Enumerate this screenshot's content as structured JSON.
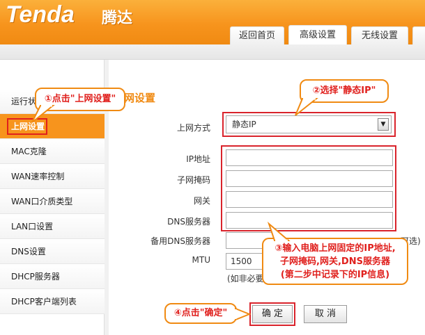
{
  "brand": {
    "logo": "Tenda",
    "logo_cn": "腾达"
  },
  "tabs": [
    {
      "label": "返回首页"
    },
    {
      "label": "高级设置"
    },
    {
      "label": "无线设置"
    },
    {
      "label": ""
    }
  ],
  "sidebar": {
    "items": [
      {
        "label": "运行状"
      },
      {
        "label": "上网设置"
      },
      {
        "label": "MAC克隆"
      },
      {
        "label": "WAN速率控制"
      },
      {
        "label": "WAN口介质类型"
      },
      {
        "label": "LAN口设置"
      },
      {
        "label": "DNS设置"
      },
      {
        "label": "DHCP服务器"
      },
      {
        "label": "DHCP客户端列表"
      }
    ]
  },
  "main": {
    "title": "网设置",
    "connection_type_label": "上网方式",
    "connection_type_value": "静态IP",
    "fields": {
      "ip_label": "IP地址",
      "mask_label": "子网掩码",
      "gateway_label": "网关",
      "dns_label": "DNS服务器",
      "dns2_label": "备用DNS服务器",
      "dns2_suffix": "可选)",
      "mtu_label": "MTU",
      "mtu_value": "1500",
      "mtu_note": "(如非必要"
    },
    "buttons": {
      "ok": "确 定",
      "cancel": "取 消"
    }
  },
  "callouts": {
    "step1": "①点击\"上网设置\"",
    "step2": "②选择\"静态IP\"",
    "step3_line1": "③输入电脑上网固定的IP地址,",
    "step3_line2": "子网掩码,网关,DNS服务器",
    "step3_line3": "(第二步中记录下的IP信息)",
    "step4": "④点击\"确定\""
  },
  "colors": {
    "accent": "#f7941d",
    "highlight": "#e0201d",
    "callout_border": "#f08a12"
  }
}
